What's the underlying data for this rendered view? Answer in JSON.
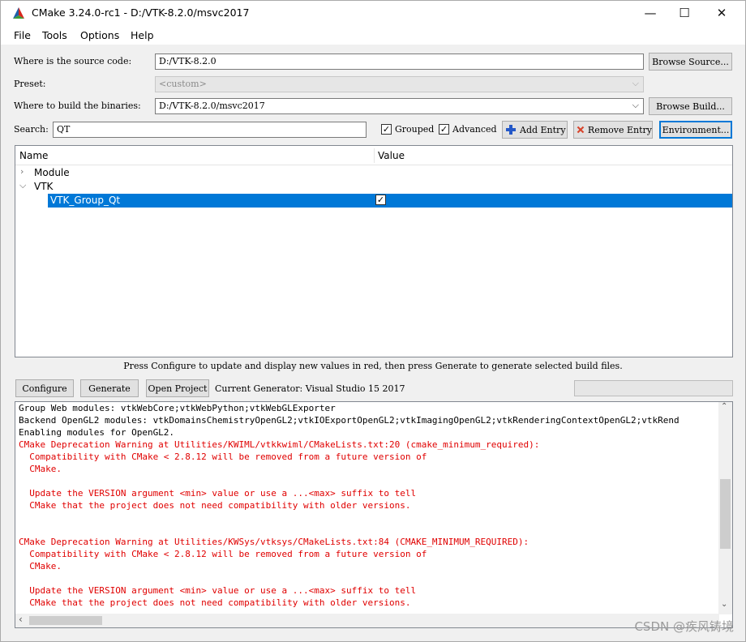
{
  "window": {
    "title": "CMake 3.24.0-rc1 - D:/VTK-8.2.0/msvc2017",
    "minimize": "—",
    "maximize": "☐",
    "close": "✕"
  },
  "menu": [
    "File",
    "Tools",
    "Options",
    "Help"
  ],
  "form": {
    "source_label": "Where is the source code:",
    "source_value": "D:/VTK-8.2.0",
    "browse_source": "Browse Source...",
    "preset_label": "Preset:",
    "preset_value": "<custom>",
    "build_label": "Where to build the binaries:",
    "build_value": "D:/VTK-8.2.0/msvc2017",
    "browse_build": "Browse Build...",
    "search_label": "Search:",
    "search_value": "QT",
    "grouped_label": "Grouped",
    "grouped_checked": true,
    "advanced_label": "Advanced",
    "advanced_checked": true,
    "add_entry": "Add Entry",
    "remove_entry": "Remove Entry",
    "environment": "Environment..."
  },
  "tree": {
    "col_name": "Name",
    "col_value": "Value",
    "rows": [
      {
        "label": "Module",
        "expanded": false
      },
      {
        "label": "VTK",
        "expanded": true
      },
      {
        "label": "VTK_Group_Qt",
        "checked": true
      }
    ]
  },
  "status": "Press Configure to update and display new values in red, then press Generate to generate selected build files.",
  "actions": {
    "configure": "Configure",
    "generate": "Generate",
    "open_project": "Open Project",
    "current_generator": "Current Generator: Visual Studio 15 2017"
  },
  "output": [
    {
      "text": "Group Web modules: vtkWebCore;vtkWebPython;vtkWebGLExporter",
      "red": false
    },
    {
      "text": "Backend OpenGL2 modules: vtkDomainsChemistryOpenGL2;vtkIOExportOpenGL2;vtkImagingOpenGL2;vtkRenderingContextOpenGL2;vtkRend",
      "red": false
    },
    {
      "text": "Enabling modules for OpenGL2.",
      "red": false
    },
    {
      "text": "CMake Deprecation Warning at Utilities/KWIML/vtkkwiml/CMakeLists.txt:20 (cmake_minimum_required):",
      "red": true
    },
    {
      "text": "  Compatibility with CMake < 2.8.12 will be removed from a future version of",
      "red": true
    },
    {
      "text": "  CMake.",
      "red": true
    },
    {
      "text": "",
      "red": true
    },
    {
      "text": "  Update the VERSION argument <min> value or use a ...<max> suffix to tell",
      "red": true
    },
    {
      "text": "  CMake that the project does not need compatibility with older versions.",
      "red": true
    },
    {
      "text": "",
      "red": true
    },
    {
      "text": "",
      "red": true
    },
    {
      "text": "CMake Deprecation Warning at Utilities/KWSys/vtksys/CMakeLists.txt:84 (CMAKE_MINIMUM_REQUIRED):",
      "red": true
    },
    {
      "text": "  Compatibility with CMake < 2.8.12 will be removed from a future version of",
      "red": true
    },
    {
      "text": "  CMake.",
      "red": true
    },
    {
      "text": "",
      "red": true
    },
    {
      "text": "  Update the VERSION argument <min> value or use a ...<max> suffix to tell",
      "red": true
    },
    {
      "text": "  CMake that the project does not need compatibility with older versions.",
      "red": true
    }
  ],
  "watermark": "CSDN @疾风铸境",
  "colors": {
    "selection": "#0078d7",
    "error_text": "#e00000"
  }
}
